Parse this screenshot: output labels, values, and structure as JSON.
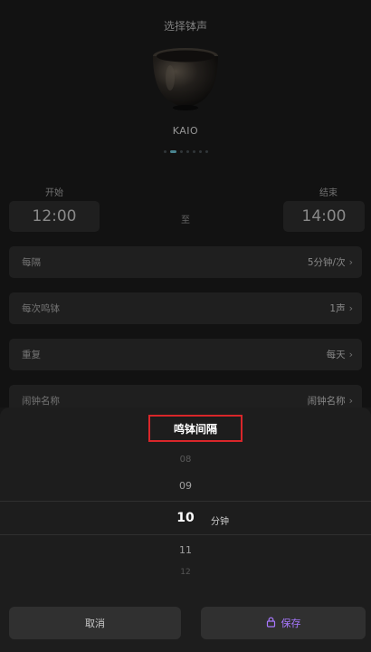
{
  "header": {
    "title": "选择钵声"
  },
  "bowl": {
    "name": "KAIO",
    "icon": "singing-bowl-image"
  },
  "carousel": {
    "count": 7,
    "active_index": 1
  },
  "schedule": {
    "start_label": "开始",
    "start_time": "12:00",
    "to_label": "至",
    "end_label": "结束",
    "end_time": "14:00"
  },
  "settings": [
    {
      "label": "每隔",
      "value": "5分钟/次"
    },
    {
      "label": "每次鸣钵",
      "value": "1声"
    },
    {
      "label": "重复",
      "value": "每天"
    },
    {
      "label": "闹钟名称",
      "value": "闹钟名称"
    }
  ],
  "sheet": {
    "title": "鸣钵间隔",
    "options": [
      "08",
      "09",
      "10",
      "11",
      "12"
    ],
    "selected": "10",
    "unit": "分钟",
    "cancel_label": "取消",
    "save_label": "保存",
    "highlight_color": "#d9262a",
    "accent_color": "#a878ff"
  }
}
